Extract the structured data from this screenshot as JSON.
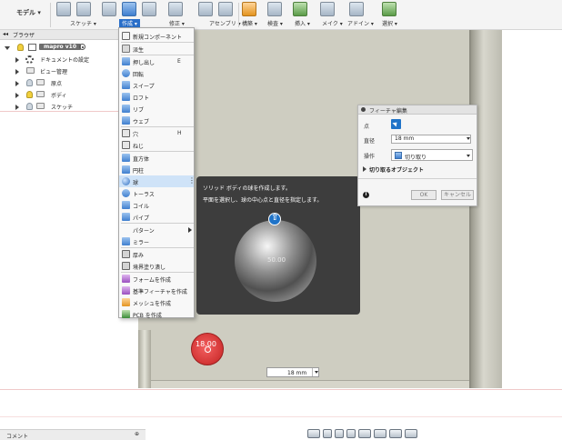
{
  "toolbar": {
    "model": "モデル ▾",
    "groups": [
      "スケッチ ▾",
      "作成 ▾",
      "修正 ▾",
      "アセンブリ ▾",
      "構築 ▾",
      "検査 ▾",
      "挿入 ▾",
      "メイク ▾",
      "アドイン ▾",
      "選択 ▾"
    ]
  },
  "browser": {
    "title": "ブラウザ",
    "items": [
      {
        "label": "mapro v10"
      },
      {
        "label": "ドキュメントの設定"
      },
      {
        "label": "ビュー管理"
      },
      {
        "label": "原点"
      },
      {
        "label": "ボディ"
      },
      {
        "label": "スケッチ"
      }
    ]
  },
  "create_menu": {
    "items": [
      {
        "label": "新規コンポーネント"
      },
      {
        "label": "派生"
      },
      {
        "label": "押し出し",
        "key": "E"
      },
      {
        "label": "回転"
      },
      {
        "label": "スイープ"
      },
      {
        "label": "ロフト"
      },
      {
        "label": "リブ"
      },
      {
        "label": "ウェブ"
      },
      {
        "label": "穴",
        "key": "H"
      },
      {
        "label": "ねじ"
      },
      {
        "label": "直方体"
      },
      {
        "label": "円柱"
      },
      {
        "label": "球"
      },
      {
        "label": "トーラス"
      },
      {
        "label": "コイル"
      },
      {
        "label": "パイプ"
      },
      {
        "label": "パターン"
      },
      {
        "label": "ミラー"
      },
      {
        "label": "厚み"
      },
      {
        "label": "境界塗り潰し"
      },
      {
        "label": "フォームを作成"
      },
      {
        "label": "基準フィーチャを作成"
      },
      {
        "label": "メッシュを作成"
      },
      {
        "label": "PCB を作成"
      }
    ]
  },
  "tooltip": {
    "title": "ソリッド ボディの球を作成します。",
    "description": "平面を選択し、球の中心点と直径を指定します。",
    "dim_label": "50.00"
  },
  "feature_dialog": {
    "title": "フィーチャ編集",
    "point_label": "点",
    "diameter_label": "直径",
    "diameter_value": "18 mm",
    "operation_label": "操作",
    "operation_value": "切り取り",
    "target_section": "切り取るオブジェクト",
    "ok": "OK",
    "cancel": "キャンセル"
  },
  "sketch_marker": "18.00",
  "value_input": "18 mm",
  "comments": "コメント",
  "colors": {
    "accent": "#2a6fc9",
    "tooltip_bg": "#3d3d3d",
    "part_surface": "#cecdc1",
    "sketch_point": "#d23434"
  }
}
